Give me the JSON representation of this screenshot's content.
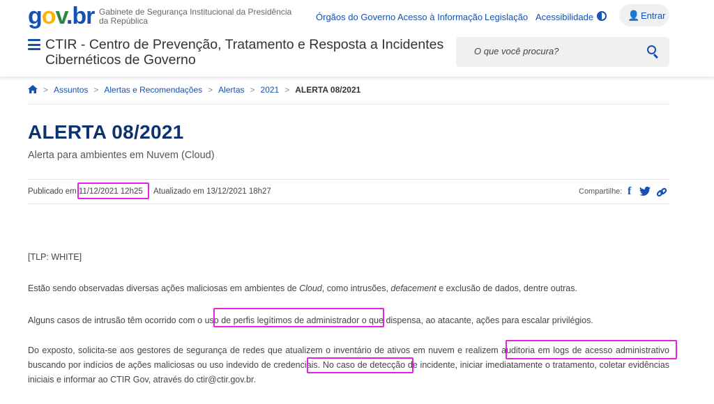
{
  "header": {
    "logo": {
      "g": "g",
      "o": "o",
      "v": "v",
      "dot": ".",
      "br": "br"
    },
    "agency": "Gabinete de Segurança Institucional da Presidência da República",
    "nav": [
      "Órgãos do Governo",
      "Acesso à Informação",
      "Legislação",
      "Acessibilidade"
    ],
    "login_label": "Entrar",
    "site_title": "CTIR - Centro de Prevenção, Tratamento e Resposta a Incidentes Cibernéticos de Governo",
    "search_placeholder": "O que você procura?"
  },
  "breadcrumb": [
    "Assuntos",
    "Alertas e Recomendações",
    "Alertas",
    "2021",
    "ALERTA 08/2021"
  ],
  "article": {
    "title": "ALERTA 08/2021",
    "subtitle": "Alerta para ambientes em Nuvem (Cloud)",
    "published_prefix": "Publicado em",
    "published": "11/12/2021 12h25",
    "updated_prefix": "Atualizado em",
    "updated": "13/12/2021 18h27",
    "share_label": "Compartilhe:",
    "tlp": "[TLP: WHITE]",
    "p1": {
      "a": "Estão sendo observadas diversas ações maliciosas em ambientes de ",
      "b": "Cloud",
      "c": ", como intrusões, ",
      "d": "defacement",
      "e": " e exclusão de dados, dentre outras."
    },
    "p2": "Alguns casos de intrusão têm ocorrido com o uso de perfis legítimos de administrador o que dispensa, ao atacante, ações para escalar privilégios.",
    "p3": "Do exposto, solicita-se aos gestores de segurança de redes que atualizem o inventário de ativos em nuvem e realizem auditoria em logs de acesso administrativo buscando por indícios de ações maliciosas ou uso indevido de credenciais. No caso de detecção de incidente, iniciar imediatamente o tratamento, coletar evidências iniciais e informar ao CTIR Gov, através do ctir@ctir.gov.br."
  },
  "colors": {
    "brand_blue": "#1351b4",
    "title_navy": "#0c326f",
    "highlight": "#e023e0"
  }
}
